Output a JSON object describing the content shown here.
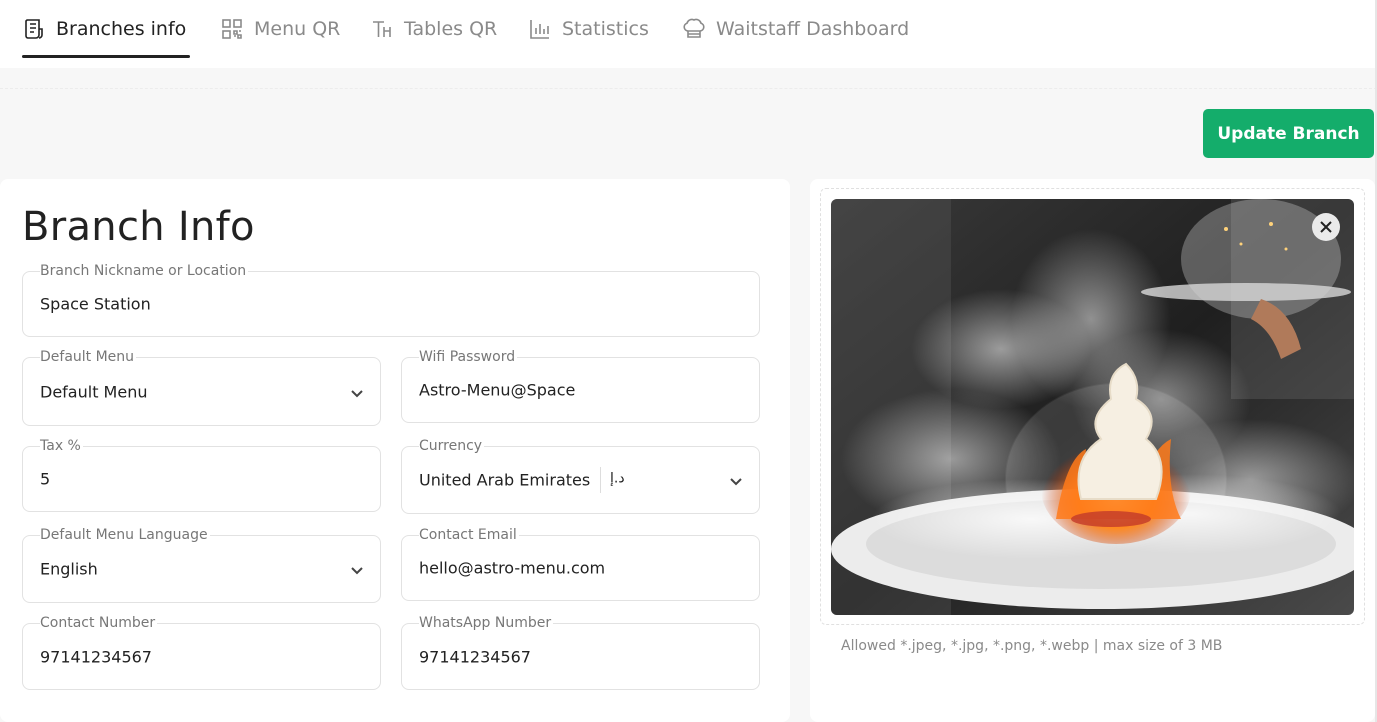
{
  "tabs": [
    {
      "label": "Branches info",
      "icon": "receipt-icon",
      "active": true
    },
    {
      "label": "Menu QR",
      "icon": "qr-code-icon",
      "active": false
    },
    {
      "label": "Tables QR",
      "icon": "table-icon",
      "active": false
    },
    {
      "label": "Statistics",
      "icon": "bar-chart-icon",
      "active": false
    },
    {
      "label": "Waitstaff Dashboard",
      "icon": "chef-hat-icon",
      "active": false
    }
  ],
  "actions": {
    "update_label": "Update Branch",
    "accent_color": "#14ad6b"
  },
  "branch": {
    "title": "Branch Info",
    "fields": {
      "nickname": {
        "label": "Branch Nickname or Location",
        "value": "Space Station"
      },
      "default_menu": {
        "label": "Default Menu",
        "value": "Default Menu"
      },
      "wifi": {
        "label": "Wifi Password",
        "value": "Astro-Menu@Space"
      },
      "tax": {
        "label": "Tax %",
        "value": "5"
      },
      "currency": {
        "label": "Currency",
        "value": "United Arab Emirates",
        "symbol": "د.إ"
      },
      "language": {
        "label": "Default Menu Language",
        "value": "English"
      },
      "email": {
        "label": "Contact Email",
        "value": "hello@astro-menu.com"
      },
      "contact_number": {
        "label": "Contact Number",
        "value": "97141234567"
      },
      "whatsapp": {
        "label": "WhatsApp Number",
        "value": "97141234567"
      }
    }
  },
  "image": {
    "description_icon": "dessert-photo",
    "allowed_text": "Allowed *.jpeg, *.jpg, *.png, *.webp | max size of 3 MB"
  }
}
